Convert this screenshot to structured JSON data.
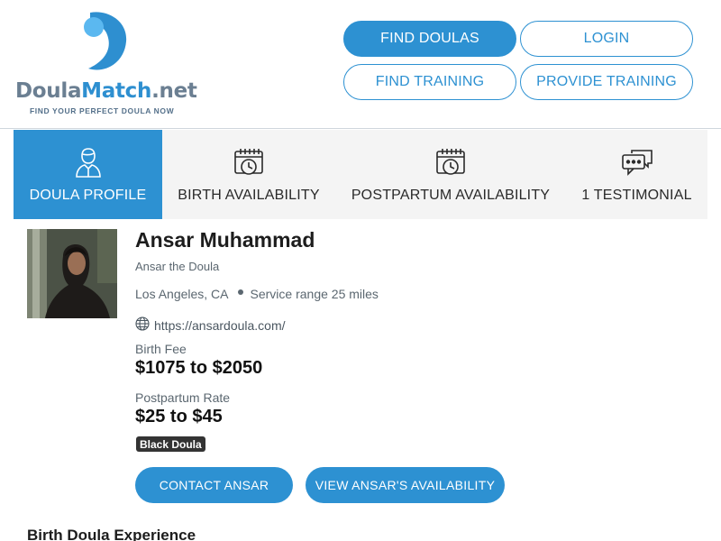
{
  "logo": {
    "part1": "Doula",
    "part2": "Match",
    "part3": ".net",
    "tagline": "FIND YOUR PERFECT DOULA NOW",
    "brand_blue": "#2e8fd0",
    "brand_light_blue": "#5bb8f0",
    "brand_gray": "#6b7f92"
  },
  "nav": {
    "find_doulas": "FIND DOULAS",
    "login": "LOGIN",
    "find_training": "FIND TRAINING",
    "provide_training": "PROVIDE TRAINING"
  },
  "tabs": [
    {
      "label": "DOULA PROFILE",
      "icon": "person-icon",
      "active": true
    },
    {
      "label": "BIRTH AVAILABILITY",
      "icon": "calendar-clock-icon",
      "active": false
    },
    {
      "label": "POSTPARTUM AVAILABILITY",
      "icon": "calendar-clock-icon",
      "active": false
    },
    {
      "label": "1 TESTIMONIAL",
      "icon": "chat-bubbles-icon",
      "active": false
    }
  ],
  "profile": {
    "name": "Ansar Muhammad",
    "subtitle": "Ansar the Doula",
    "city": "Los Angeles, CA",
    "service_range": "Service range 25 miles",
    "website": "https://ansardoula.com/",
    "birth_fee_label": "Birth Fee",
    "birth_fee": "$1075 to $2050",
    "postpartum_label": "Postpartum Rate",
    "postpartum_rate": "$25 to $45",
    "badge": "Black Doula"
  },
  "actions": {
    "contact": "CONTACT ANSAR",
    "availability": "VIEW ANSAR'S AVAILABILITY"
  },
  "sections": {
    "experience_title": "Birth Doula Experience"
  },
  "colors": {
    "accent": "#2d91d2",
    "tab_bg": "#f4f4f4",
    "badge_bg": "#333333"
  }
}
